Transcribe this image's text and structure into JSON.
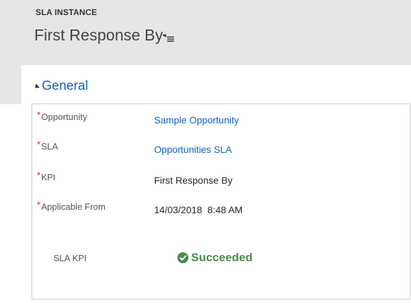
{
  "header": {
    "entity_type": "SLA INSTANCE",
    "record_title": "First Response By",
    "form_selector_icon": "list-menu-icon"
  },
  "section": {
    "title": "General",
    "toggle_icon": "collapse-triangle-icon"
  },
  "fields": [
    {
      "label": "Opportunity",
      "required": true,
      "value": "Sample Opportunity",
      "is_link": true
    },
    {
      "label": "SLA",
      "required": true,
      "value": "Opportunities SLA",
      "is_link": true
    },
    {
      "label": "KPI",
      "required": true,
      "value": "First Response By",
      "is_link": false
    },
    {
      "label": "Applicable From",
      "required": true,
      "value": "14/03/2018  8:48 AM",
      "is_link": false
    }
  ],
  "sla_kpi": {
    "label": "SLA KPI",
    "status": "Succeeded",
    "status_icon": "check-circle-icon",
    "status_color": "#4a8a4e"
  },
  "colors": {
    "header_bg": "#e6e6e6",
    "link": "#1160b7",
    "required": "#e81123"
  },
  "required_marker": "*"
}
